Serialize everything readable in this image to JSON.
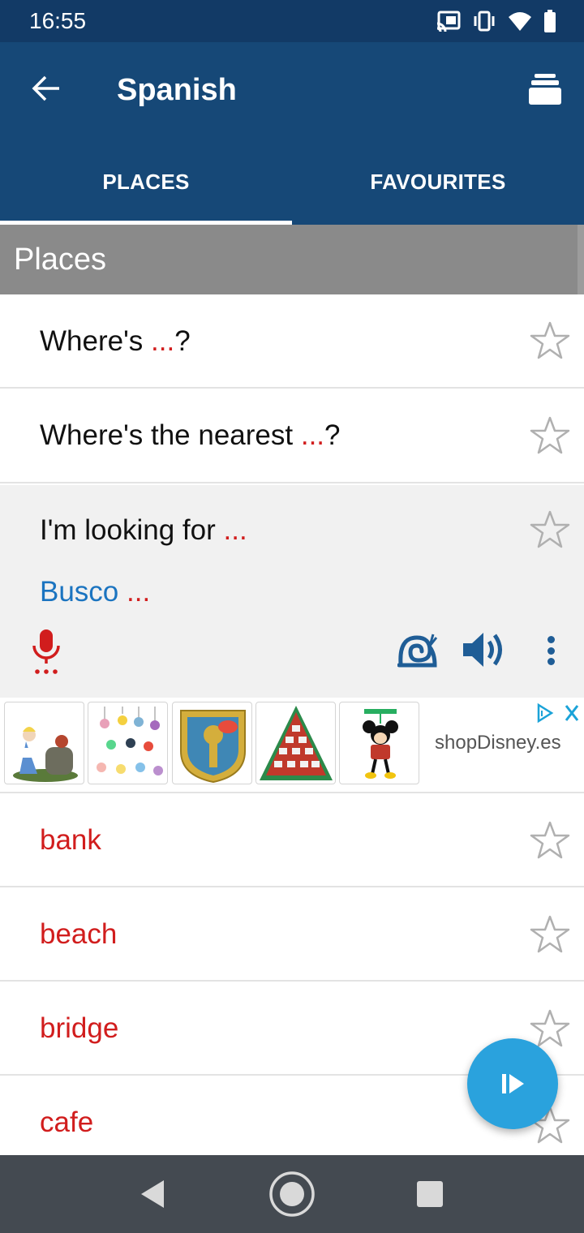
{
  "status_bar": {
    "time": "16:55",
    "icons": [
      "cast-icon",
      "vibrate-icon",
      "wifi-icon",
      "battery-icon"
    ]
  },
  "app_bar": {
    "title": "Spanish",
    "back_icon": "arrow-left-icon",
    "menu_icon": "stack-icon"
  },
  "tabs": [
    {
      "label": "PLACES",
      "selected": true
    },
    {
      "label": "FAVOURITES",
      "selected": false
    }
  ],
  "section": {
    "title": "Places"
  },
  "phrases": [
    {
      "before": "Where's ",
      "placeholder": "...",
      "after": "?"
    },
    {
      "before": "Where's the nearest ",
      "placeholder": "...",
      "after": "?"
    },
    {
      "before": "I'm looking for ",
      "placeholder": "...",
      "after": "",
      "expanded": true,
      "translation_before": "Busco ",
      "translation_placeholder": "..."
    }
  ],
  "ad": {
    "brand": "shopDisney.es",
    "thumbnails": [
      "alice-figurine",
      "ornament-set",
      "pluto-pin",
      "advent-calendar",
      "mickey-ornament"
    ]
  },
  "words": [
    {
      "label": "bank"
    },
    {
      "label": "beach"
    },
    {
      "label": "bridge"
    },
    {
      "label": "cafe"
    }
  ],
  "colors": {
    "app_bar": "#164877",
    "status_bar": "#123a66",
    "accent_red": "#d11d1d",
    "translation_blue": "#1b74c0",
    "fab": "#2aa2dd"
  }
}
